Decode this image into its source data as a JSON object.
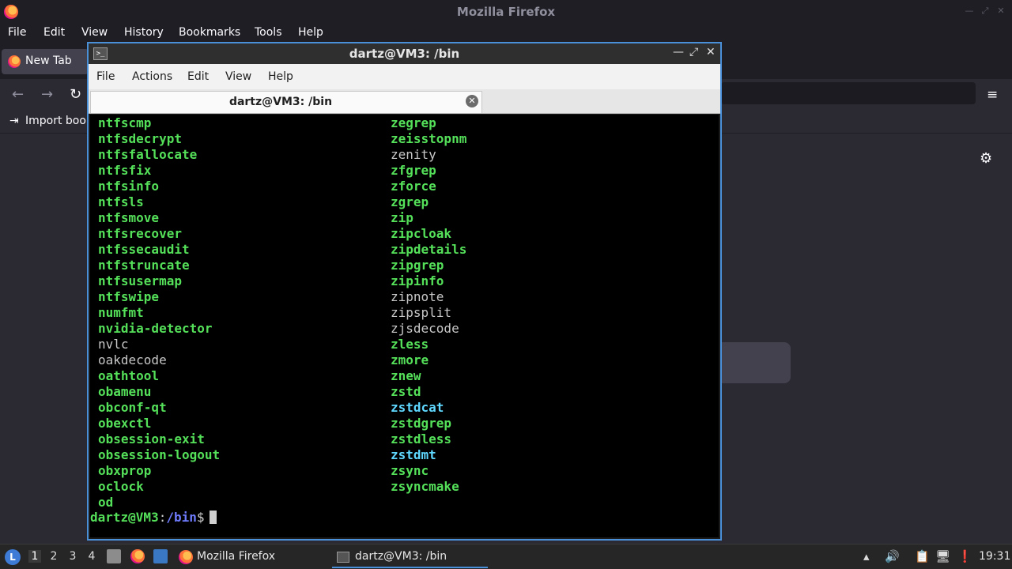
{
  "firefox": {
    "window_title": "Mozilla Firefox",
    "menu": [
      "File",
      "Edit",
      "View",
      "History",
      "Bookmarks",
      "Tools",
      "Help"
    ],
    "tab_label": "New Tab",
    "bookmark_import_label": "Import book",
    "icons": {
      "back": "←",
      "forward": "→",
      "reload": "↻",
      "hamburger": "≡",
      "gear": "⚙",
      "import": "⇥"
    }
  },
  "terminal": {
    "window_title": "dartz@VM3: /bin",
    "menu": [
      "File",
      "Actions",
      "Edit",
      "View",
      "Help"
    ],
    "tab_label": "dartz@VM3: /bin",
    "left_column": [
      {
        "text": "ntfscmp",
        "style": "exe"
      },
      {
        "text": "ntfsdecrypt",
        "style": "exe"
      },
      {
        "text": "ntfsfallocate",
        "style": "exe"
      },
      {
        "text": "ntfsfix",
        "style": "exe"
      },
      {
        "text": "ntfsinfo",
        "style": "exe"
      },
      {
        "text": "ntfsls",
        "style": "exe"
      },
      {
        "text": "ntfsmove",
        "style": "exe"
      },
      {
        "text": "ntfsrecover",
        "style": "exe"
      },
      {
        "text": "ntfssecaudit",
        "style": "exe"
      },
      {
        "text": "ntfstruncate",
        "style": "exe"
      },
      {
        "text": "ntfsusermap",
        "style": "exe"
      },
      {
        "text": "ntfswipe",
        "style": "exe"
      },
      {
        "text": "numfmt",
        "style": "exe"
      },
      {
        "text": "nvidia-detector",
        "style": "exe"
      },
      {
        "text": "nvlc",
        "style": "plain"
      },
      {
        "text": "oakdecode",
        "style": "plain"
      },
      {
        "text": "oathtool",
        "style": "exe"
      },
      {
        "text": "obamenu",
        "style": "exe"
      },
      {
        "text": "obconf-qt",
        "style": "exe"
      },
      {
        "text": "obexctl",
        "style": "exe"
      },
      {
        "text": "obsession-exit",
        "style": "exe"
      },
      {
        "text": "obsession-logout",
        "style": "exe"
      },
      {
        "text": "obxprop",
        "style": "exe"
      },
      {
        "text": "oclock",
        "style": "exe"
      },
      {
        "text": "od",
        "style": "exe"
      }
    ],
    "right_column": [
      {
        "text": "zegrep",
        "style": "exe"
      },
      {
        "text": "zeisstopnm",
        "style": "exe"
      },
      {
        "text": "zenity",
        "style": "plain"
      },
      {
        "text": "zfgrep",
        "style": "exe"
      },
      {
        "text": "zforce",
        "style": "exe"
      },
      {
        "text": "zgrep",
        "style": "exe"
      },
      {
        "text": "zip",
        "style": "exe"
      },
      {
        "text": "zipcloak",
        "style": "exe"
      },
      {
        "text": "zipdetails",
        "style": "exe"
      },
      {
        "text": "zipgrep",
        "style": "exe"
      },
      {
        "text": "zipinfo",
        "style": "exe"
      },
      {
        "text": "zipnote",
        "style": "plain"
      },
      {
        "text": "zipsplit",
        "style": "plain"
      },
      {
        "text": "zjsdecode",
        "style": "plain"
      },
      {
        "text": "zless",
        "style": "exe"
      },
      {
        "text": "zmore",
        "style": "exe"
      },
      {
        "text": "znew",
        "style": "exe"
      },
      {
        "text": "zstd",
        "style": "exe"
      },
      {
        "text": "zstdcat",
        "style": "cyan"
      },
      {
        "text": "zstdgrep",
        "style": "exe"
      },
      {
        "text": "zstdless",
        "style": "exe"
      },
      {
        "text": "zstdmt",
        "style": "cyan"
      },
      {
        "text": "zsync",
        "style": "exe"
      },
      {
        "text": "zsyncmake",
        "style": "exe"
      }
    ],
    "prompt": {
      "user_host": "dartz@VM3",
      "separator": ":",
      "path": "/bin",
      "sign": "$"
    },
    "colors": {
      "exe": "#55e05a",
      "plain": "#c8c8c8",
      "link": "#5fd7ff",
      "path": "#6f7cff",
      "border": "#4a90d9"
    }
  },
  "taskbar": {
    "desktops": [
      "1",
      "2",
      "3",
      "4"
    ],
    "active_desktop": "1",
    "tasks": [
      {
        "label": "Mozilla Firefox",
        "icon": "firefox-icon"
      },
      {
        "label": "dartz@VM3: /bin",
        "icon": "terminal-icon"
      }
    ],
    "clock": "19:31"
  }
}
